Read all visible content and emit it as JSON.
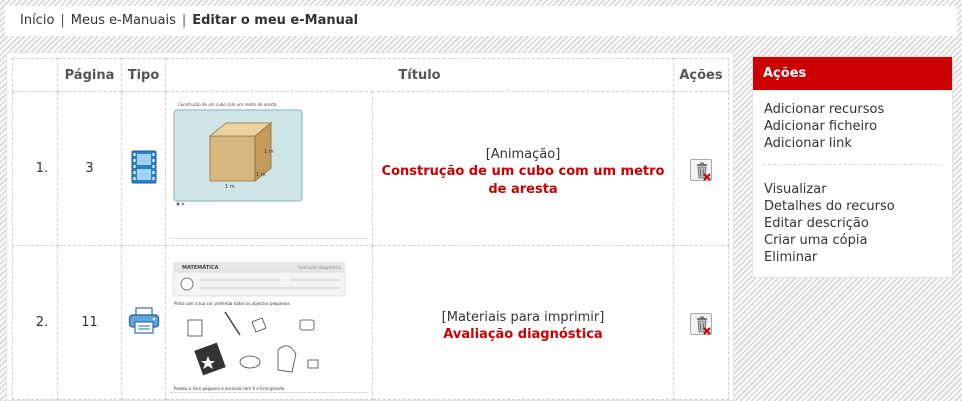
{
  "breadcrumb": {
    "home": "Início",
    "manuals": "Meus e-Manuais",
    "current": "Editar o meu e-Manual",
    "separator": "|"
  },
  "table": {
    "headers": {
      "page": "Página",
      "type": "Tipo",
      "title": "Título",
      "actions": "Ações"
    },
    "rows": [
      {
        "index": "1.",
        "page": "3",
        "type_icon": "film-icon",
        "category": "[Animação]",
        "title": "Construção de um cubo com um metro de aresta",
        "thumb_caption": "Construção de um cubo com um metro de aresta",
        "thumb_labels": [
          "1 m",
          "1 m",
          "1 m"
        ]
      },
      {
        "index": "2.",
        "page": "11",
        "type_icon": "printer-icon",
        "category": "[Materiais para imprimir]",
        "title": "Avaliação diagnóstica",
        "thumb_header": "MATEMÁTICA",
        "thumb_header_right": "Avaliação diagnóstica",
        "thumb_q1": "Pinta com a tua cor preferida todos os objectos pequenos.",
        "thumb_q2": "Rodeia o livro pequeno e assinala com X o livro grande."
      }
    ]
  },
  "sidebar": {
    "header": "Ações",
    "group1": [
      "Adicionar recursos",
      "Adicionar ficheiro",
      "Adicionar link"
    ],
    "group2": [
      "Visualizar",
      "Detalhes do recurso",
      "Editar descrição",
      "Criar uma cópia",
      "Eliminar"
    ]
  },
  "colors": {
    "accent": "#cc0000",
    "thumb_bg": "#cfe4e6"
  }
}
